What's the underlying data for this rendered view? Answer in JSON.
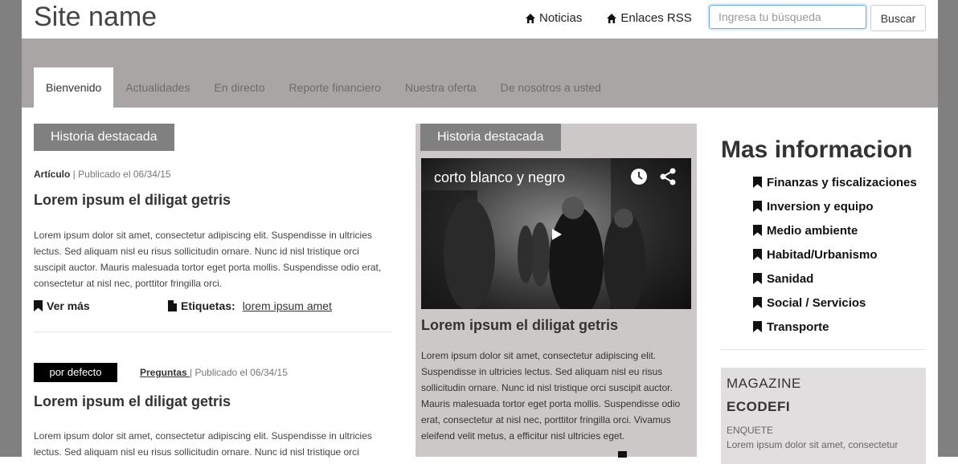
{
  "header": {
    "site_name": "Site name",
    "links": [
      {
        "label": "Noticias",
        "icon": "home-icon"
      },
      {
        "label": "Enlaces RSS",
        "icon": "home-icon"
      }
    ],
    "search_placeholder": "Ingresa tu búsqueda",
    "search_button": "Buscar"
  },
  "nav": {
    "tabs": [
      {
        "label": "Bienvenido",
        "active": true
      },
      {
        "label": "Actualidades"
      },
      {
        "label": "En directo"
      },
      {
        "label": "Reporte financiero"
      },
      {
        "label": "Nuestra oferta"
      },
      {
        "label": "De nosotros a usted"
      }
    ]
  },
  "left": {
    "section_label": "Historia destacada",
    "article1": {
      "type": "Artículo",
      "sep": " | ",
      "published": "Publicado el 06/34/15",
      "headline": "Lorem ipsum el diligat getris",
      "body": "Lorem ipsum dolor sit amet, consectetur adipiscing elit. Suspendisse in ultricies lectus. Sed aliquam nisl eu risus sollicitudin ornare. Nunc id nisl tristique orci suscipit auctor. Mauris malesuada tortor eget porta mollis. Suspendisse odio erat, consectetur at nisl nec, porttitor fringilla orci.",
      "more": "Ver más",
      "tags_label": "Etiquetas:",
      "tags_link": "lorem ipsum amet"
    },
    "article2": {
      "badge": "por defecto",
      "category": "Preguntas ",
      "sep": "| ",
      "published": "Publicado el 06/34/15",
      "headline": "Lorem ipsum el diligat getris",
      "body": "Lorem ipsum dolor sit amet, consectetur adipiscing elit. Suspendisse in ultricies lectus. Sed aliquam nisl eu risus sollicitudin ornare. Nunc id nisl tristique orci"
    }
  },
  "middle": {
    "section_label": "Historia destacada",
    "video_title": "corto blanco y negro",
    "headline": "Lorem ipsum el diligat getris",
    "body": "Lorem ipsum dolor sit amet, consectetur adipiscing elit. Suspendisse in ultricies lectus. Sed aliquam nisl eu risus sollicitudin ornare. Nunc id nisl tristique orci suscipit auctor. Mauris malesuada tortor eget porta mollis. Suspendisse odio erat, consectetur at nisl nec, porttitor fringilla orci. Vivamus eleifend velit metus, a efficitur nisl ultricies eget."
  },
  "right": {
    "title": "Mas informacion",
    "items": [
      "Finanzas y fiscalizaciones",
      "Inversion y equipo",
      "Medio ambiente",
      "Habitad/Urbanismo",
      "Sanidad",
      "Social / Servicios",
      "Transporte"
    ],
    "magazine": {
      "label": "MAGAZINE",
      "name": "ECODEFI",
      "kicker": "ENQUETE",
      "text": "Lorem ipsum dolor sit amet, consectetur"
    }
  }
}
